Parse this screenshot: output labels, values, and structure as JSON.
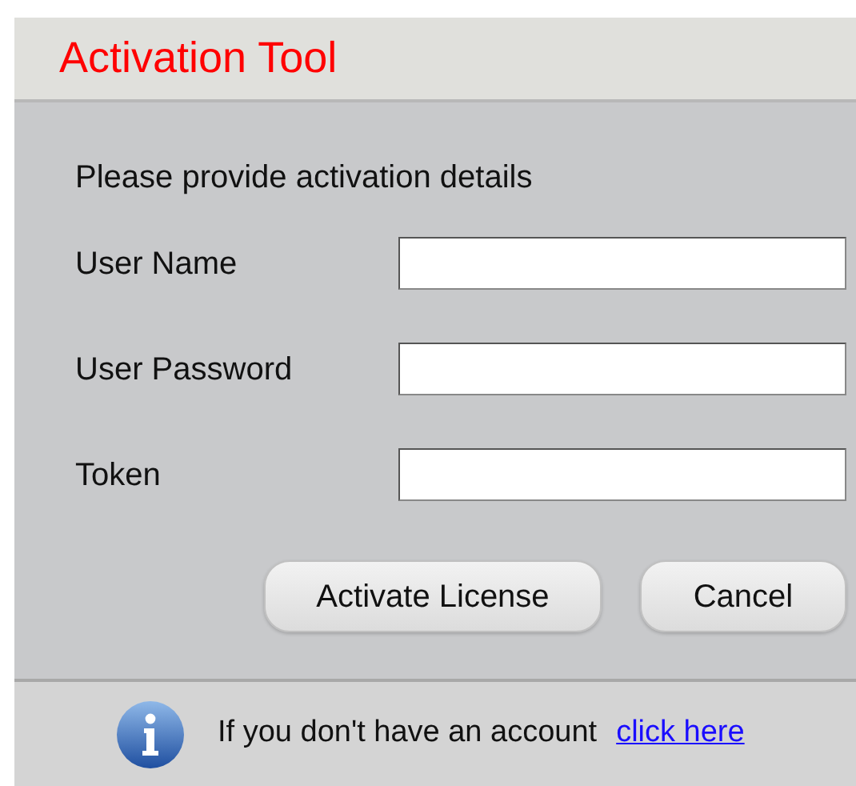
{
  "window": {
    "title": "Activation Tool"
  },
  "instruction": "Please provide activation details",
  "fields": [
    {
      "label": "User Name"
    },
    {
      "label": "User Password"
    },
    {
      "label": "Token"
    }
  ],
  "buttons": [
    "Activate License",
    "Cancel"
  ],
  "footer": {
    "text": "If you don't have an account",
    "link": "click here"
  }
}
